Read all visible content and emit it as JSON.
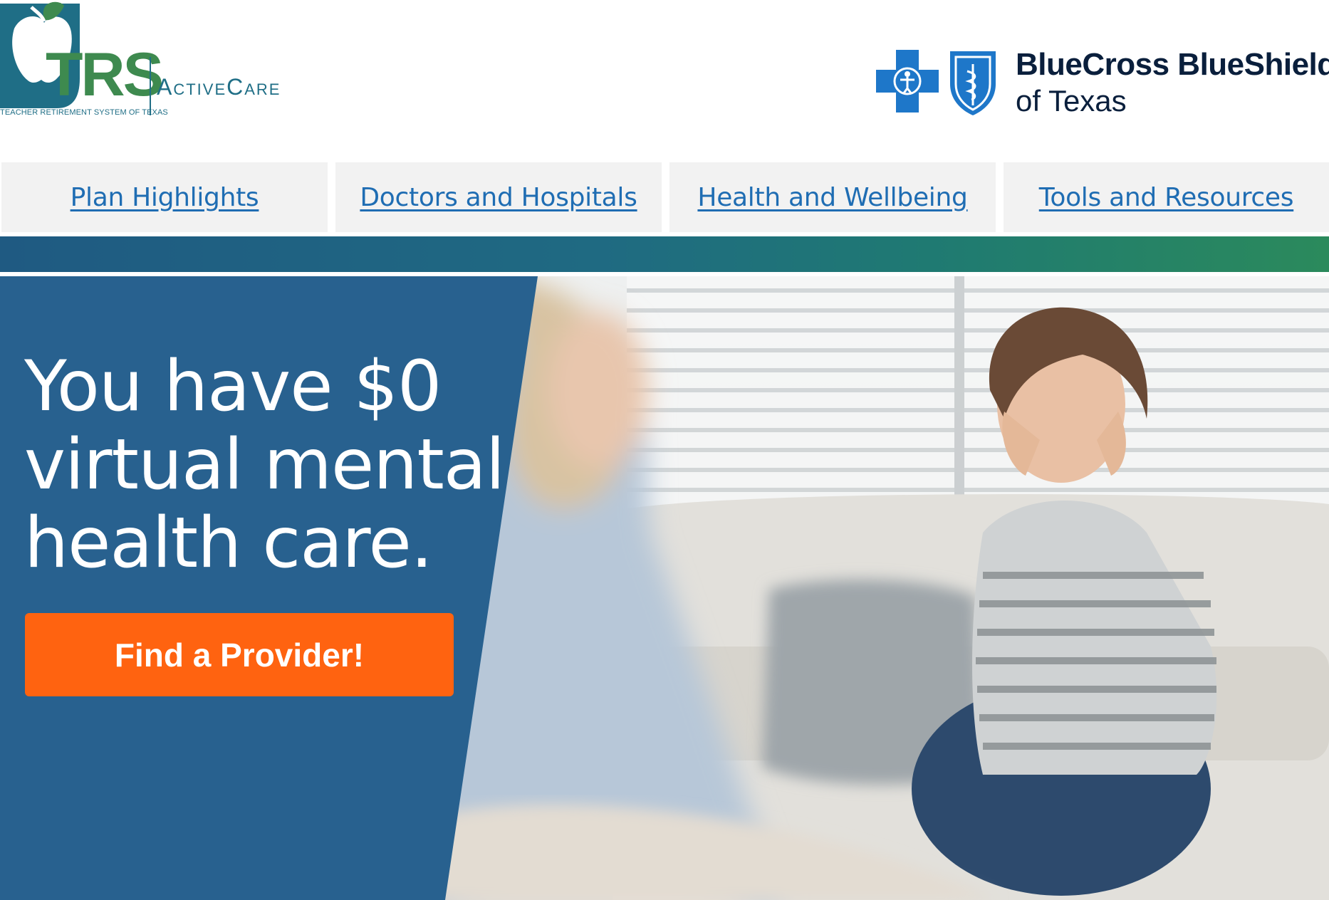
{
  "header": {
    "trs_logo": {
      "wordmark": "TRS",
      "subtitle": "TEACHER RETIREMENT SYSTEM OF TEXAS",
      "product": "ActiveCare"
    },
    "bcbs_logo": {
      "name": "BlueCross BlueShield",
      "region": "of Texas"
    }
  },
  "nav": {
    "items": [
      {
        "label": "Plan Highlights"
      },
      {
        "label": "Doctors and Hospitals"
      },
      {
        "label": "Health and Wellbeing"
      },
      {
        "label": "Tools and Resources"
      }
    ]
  },
  "hero": {
    "headline_lines": [
      "You have $0",
      "virtual mental",
      "health care."
    ],
    "cta_label": "Find a Provider!"
  },
  "colors": {
    "brand_green": "#3e8a4f",
    "brand_teal": "#1f6e86",
    "bcbs_blue": "#1e77c9",
    "nav_link": "#1f6db3",
    "hero_panel": "#28618f",
    "cta_orange": "#ff6310"
  },
  "icons": {
    "trs_apple": "apple-icon",
    "bcbs_cross": "blue-cross-icon",
    "bcbs_shield": "blue-shield-icon"
  }
}
